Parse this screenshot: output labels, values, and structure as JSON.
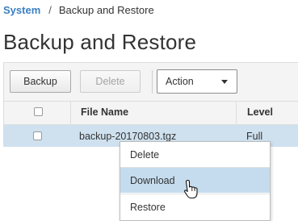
{
  "breadcrumb": {
    "parent": "System",
    "separator": "/",
    "current": "Backup and Restore"
  },
  "page_title": "Backup and Restore",
  "toolbar": {
    "backup_label": "Backup",
    "delete_label": "Delete",
    "action_select": {
      "value": "Action"
    }
  },
  "table": {
    "headers": {
      "file_name": "File Name",
      "level": "Level"
    },
    "rows": [
      {
        "file_name": "backup-20170803.tgz",
        "level": "Full",
        "selected": true
      }
    ]
  },
  "context_menu": {
    "items": [
      {
        "label": "Delete"
      },
      {
        "label": "Download",
        "highlighted": true
      },
      {
        "label": "Restore"
      }
    ]
  },
  "colors": {
    "link": "#3a7fc1",
    "selected_row": "#cfe1ef",
    "menu_highlight": "#c5dcee",
    "toolbar_bg": "#f4f4f4"
  },
  "icons": {
    "cursor": "hand-pointer-icon",
    "select_caret": "caret-down-icon"
  }
}
